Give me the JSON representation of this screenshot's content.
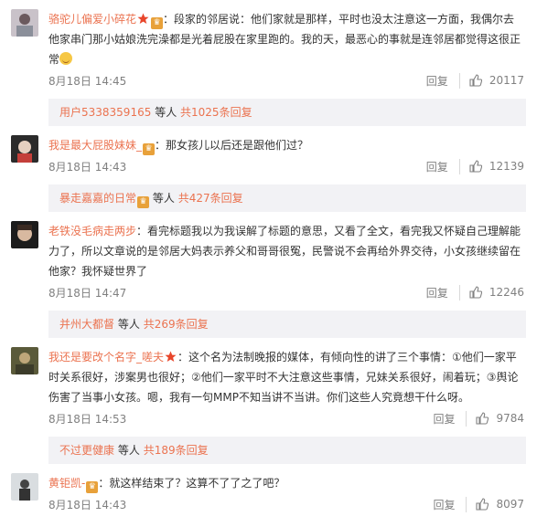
{
  "comments": [
    {
      "user": "骆驼儿偏爱小碎花",
      "has_star": true,
      "has_crown": true,
      "text": "段家的邻居说：他们家就是那样，平时也没太注意这一方面，我偶尔去他家串门那小姑娘洗完澡都是光着屁股在家里跑的。我的天，最恶心的事就是连邻居都觉得这很正常",
      "emoji_after": true,
      "time": "8月18日 14:45",
      "reply_label": "回复",
      "likes": "20117",
      "sub_user": "用户5338359165",
      "sub_others": "等人",
      "sub_count": "共1025条回复"
    },
    {
      "user": "我是最大屁股妹妹_",
      "has_star": false,
      "has_crown": true,
      "text": "那女孩儿以后还是跟他们过？",
      "emoji_after": false,
      "time": "8月18日 14:43",
      "reply_label": "回复",
      "likes": "12139",
      "sub_user": "暴走嘉嘉的日常",
      "sub_others": "等人",
      "sub_count": "共427条回复"
    },
    {
      "user": "老铁没毛病走两步",
      "has_star": false,
      "has_crown": false,
      "text": "看完标题我以为我误解了标题的意思，又看了全文，看完我又怀疑自己理解能力了，所以文章说的是邻居大妈表示养父和哥哥很冤，民警说不会再给外界交待，小女孩继续留在他家？我怀疑世界了",
      "emoji_after": false,
      "time": "8月18日 14:47",
      "reply_label": "回复",
      "likes": "12246",
      "sub_user": "并州大都督",
      "sub_others": "等人",
      "sub_count": "共269条回复"
    },
    {
      "user": "我还是要改个名字_嗟夫",
      "has_star": true,
      "has_crown": false,
      "text": "这个名为法制晚报的媒体，有倾向性的讲了三个事情：①他们一家平时关系很好，涉案男也很好；②他们一家平时不大注意这些事情，兄妹关系很好，闹着玩；③舆论伤害了当事小女孩。嗯，我有一句MMP不知当讲不当讲。你们这些人究竟想干什么呀。",
      "emoji_after": false,
      "time": "8月18日 14:53",
      "reply_label": "回复",
      "likes": "9784",
      "sub_user": "不过更健康",
      "sub_others": "等人",
      "sub_count": "共189条回复"
    },
    {
      "user": "黄钜凯-",
      "has_star": false,
      "has_crown": true,
      "text": "就这样结束了？这算不了了之了吧？",
      "emoji_after": false,
      "time": "8月18日 14:43",
      "reply_label": "回复",
      "likes": "8097"
    }
  ],
  "colors": {
    "link": "#eb7350",
    "meta": "#808080",
    "sub_bg": "#f2f2f5"
  },
  "icons": {
    "like": "thumbs-up-icon",
    "crown": "member-crown-icon",
    "star": "star-icon"
  }
}
